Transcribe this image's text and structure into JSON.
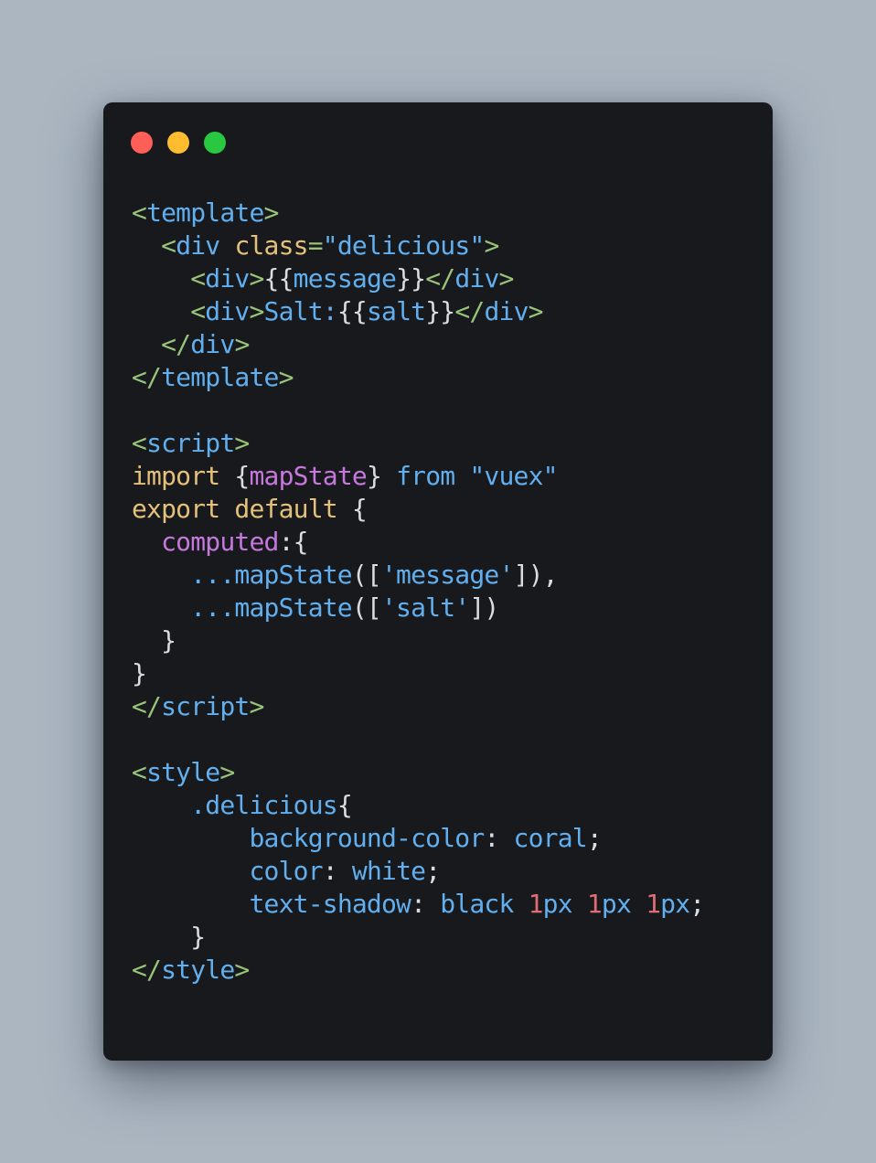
{
  "colors": {
    "background": "#abb6c1",
    "window": "#17191c",
    "dot_close": "#ff5f57",
    "dot_minimize": "#febc2e",
    "dot_maximize": "#28c840",
    "tag": "#98c379",
    "name": "#61afef",
    "attr": "#e5c07b",
    "string": "#61afef",
    "keyword": "#e5c07b",
    "variable": "#c678dd",
    "plain": "#d8dde3",
    "number": "#e06c75"
  },
  "window_controls": [
    {
      "name": "close-dot",
      "color_key": "dot_close"
    },
    {
      "name": "minimize-dot",
      "color_key": "dot_minimize"
    },
    {
      "name": "maximize-dot",
      "color_key": "dot_maximize"
    }
  ],
  "code_lines": [
    [
      {
        "t": "<",
        "c": "tag"
      },
      {
        "t": "template",
        "c": "name"
      },
      {
        "t": ">",
        "c": "tag"
      }
    ],
    [
      {
        "t": "  ",
        "c": "plain"
      },
      {
        "t": "<",
        "c": "tag"
      },
      {
        "t": "div",
        "c": "name"
      },
      {
        "t": " ",
        "c": "plain"
      },
      {
        "t": "class",
        "c": "attr"
      },
      {
        "t": "=",
        "c": "tag"
      },
      {
        "t": "\"delicious\"",
        "c": "string"
      },
      {
        "t": ">",
        "c": "tag"
      }
    ],
    [
      {
        "t": "    ",
        "c": "plain"
      },
      {
        "t": "<",
        "c": "tag"
      },
      {
        "t": "div",
        "c": "name"
      },
      {
        "t": ">",
        "c": "tag"
      },
      {
        "t": "{{",
        "c": "plain"
      },
      {
        "t": "message",
        "c": "name"
      },
      {
        "t": "}}",
        "c": "plain"
      },
      {
        "t": "</",
        "c": "tag"
      },
      {
        "t": "div",
        "c": "name"
      },
      {
        "t": ">",
        "c": "tag"
      }
    ],
    [
      {
        "t": "    ",
        "c": "plain"
      },
      {
        "t": "<",
        "c": "tag"
      },
      {
        "t": "div",
        "c": "name"
      },
      {
        "t": ">",
        "c": "tag"
      },
      {
        "t": "Salt:",
        "c": "name"
      },
      {
        "t": "{{",
        "c": "plain"
      },
      {
        "t": "salt",
        "c": "name"
      },
      {
        "t": "}}",
        "c": "plain"
      },
      {
        "t": "</",
        "c": "tag"
      },
      {
        "t": "div",
        "c": "name"
      },
      {
        "t": ">",
        "c": "tag"
      }
    ],
    [
      {
        "t": "  ",
        "c": "plain"
      },
      {
        "t": "</",
        "c": "tag"
      },
      {
        "t": "div",
        "c": "name"
      },
      {
        "t": ">",
        "c": "tag"
      }
    ],
    [
      {
        "t": "</",
        "c": "tag"
      },
      {
        "t": "template",
        "c": "name"
      },
      {
        "t": ">",
        "c": "tag"
      }
    ],
    [],
    [
      {
        "t": "<",
        "c": "tag"
      },
      {
        "t": "script",
        "c": "name"
      },
      {
        "t": ">",
        "c": "tag"
      }
    ],
    [
      {
        "t": "import",
        "c": "keyword"
      },
      {
        "t": " {",
        "c": "plain"
      },
      {
        "t": "mapState",
        "c": "variable"
      },
      {
        "t": "} ",
        "c": "plain"
      },
      {
        "t": "from",
        "c": "name"
      },
      {
        "t": " ",
        "c": "plain"
      },
      {
        "t": "\"vuex\"",
        "c": "string"
      }
    ],
    [
      {
        "t": "export",
        "c": "keyword"
      },
      {
        "t": " ",
        "c": "plain"
      },
      {
        "t": "default",
        "c": "keyword"
      },
      {
        "t": " {",
        "c": "plain"
      }
    ],
    [
      {
        "t": "  ",
        "c": "plain"
      },
      {
        "t": "computed",
        "c": "variable"
      },
      {
        "t": ":{",
        "c": "plain"
      }
    ],
    [
      {
        "t": "    ",
        "c": "plain"
      },
      {
        "t": "...mapState",
        "c": "name"
      },
      {
        "t": "([",
        "c": "plain"
      },
      {
        "t": "'message'",
        "c": "string"
      },
      {
        "t": "]),",
        "c": "plain"
      }
    ],
    [
      {
        "t": "    ",
        "c": "plain"
      },
      {
        "t": "...mapState",
        "c": "name"
      },
      {
        "t": "([",
        "c": "plain"
      },
      {
        "t": "'salt'",
        "c": "string"
      },
      {
        "t": "])",
        "c": "plain"
      }
    ],
    [
      {
        "t": "  }",
        "c": "plain"
      }
    ],
    [
      {
        "t": "}",
        "c": "plain"
      }
    ],
    [
      {
        "t": "</",
        "c": "tag"
      },
      {
        "t": "script",
        "c": "name"
      },
      {
        "t": ">",
        "c": "tag"
      }
    ],
    [],
    [
      {
        "t": "<",
        "c": "tag"
      },
      {
        "t": "style",
        "c": "name"
      },
      {
        "t": ">",
        "c": "tag"
      }
    ],
    [
      {
        "t": "    ",
        "c": "plain"
      },
      {
        "t": ".delicious",
        "c": "name"
      },
      {
        "t": "{",
        "c": "plain"
      }
    ],
    [
      {
        "t": "        ",
        "c": "plain"
      },
      {
        "t": "background-color",
        "c": "name"
      },
      {
        "t": ": ",
        "c": "plain"
      },
      {
        "t": "coral",
        "c": "name"
      },
      {
        "t": ";",
        "c": "plain"
      }
    ],
    [
      {
        "t": "        ",
        "c": "plain"
      },
      {
        "t": "color",
        "c": "name"
      },
      {
        "t": ": ",
        "c": "plain"
      },
      {
        "t": "white",
        "c": "name"
      },
      {
        "t": ";",
        "c": "plain"
      }
    ],
    [
      {
        "t": "        ",
        "c": "plain"
      },
      {
        "t": "text-shadow",
        "c": "name"
      },
      {
        "t": ": ",
        "c": "plain"
      },
      {
        "t": "black",
        "c": "name"
      },
      {
        "t": " ",
        "c": "plain"
      },
      {
        "t": "1",
        "c": "number"
      },
      {
        "t": "px",
        "c": "name"
      },
      {
        "t": " ",
        "c": "plain"
      },
      {
        "t": "1",
        "c": "number"
      },
      {
        "t": "px",
        "c": "name"
      },
      {
        "t": " ",
        "c": "plain"
      },
      {
        "t": "1",
        "c": "number"
      },
      {
        "t": "px",
        "c": "name"
      },
      {
        "t": ";",
        "c": "plain"
      }
    ],
    [
      {
        "t": "    }",
        "c": "plain"
      }
    ],
    [
      {
        "t": "</",
        "c": "tag"
      },
      {
        "t": "style",
        "c": "name"
      },
      {
        "t": ">",
        "c": "tag"
      }
    ]
  ]
}
